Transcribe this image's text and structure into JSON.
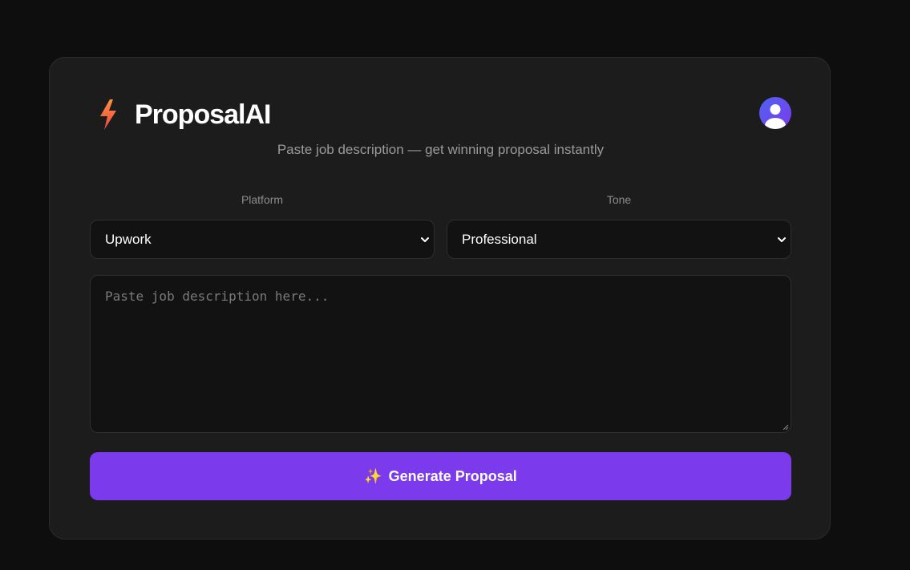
{
  "app": {
    "title": "ProposalAI",
    "subtitle": "Paste job description — get winning proposal instantly",
    "logo_icon": "lightning-bolt-icon",
    "avatar_icon": "user-avatar-icon"
  },
  "form": {
    "platform": {
      "label": "Platform",
      "selected": "Upwork"
    },
    "tone": {
      "label": "Tone",
      "selected": "Professional"
    },
    "job_description": {
      "value": "",
      "placeholder": "Paste job description here..."
    },
    "generate_button": {
      "icon": "sparkles-icon",
      "icon_glyph": "✨",
      "label": "Generate Proposal"
    }
  },
  "colors": {
    "background": "#0e0e0e",
    "card": "#1c1c1c",
    "accent": "#7c3aed",
    "bolt_start": "#fb923c",
    "bolt_end": "#ef4444"
  }
}
